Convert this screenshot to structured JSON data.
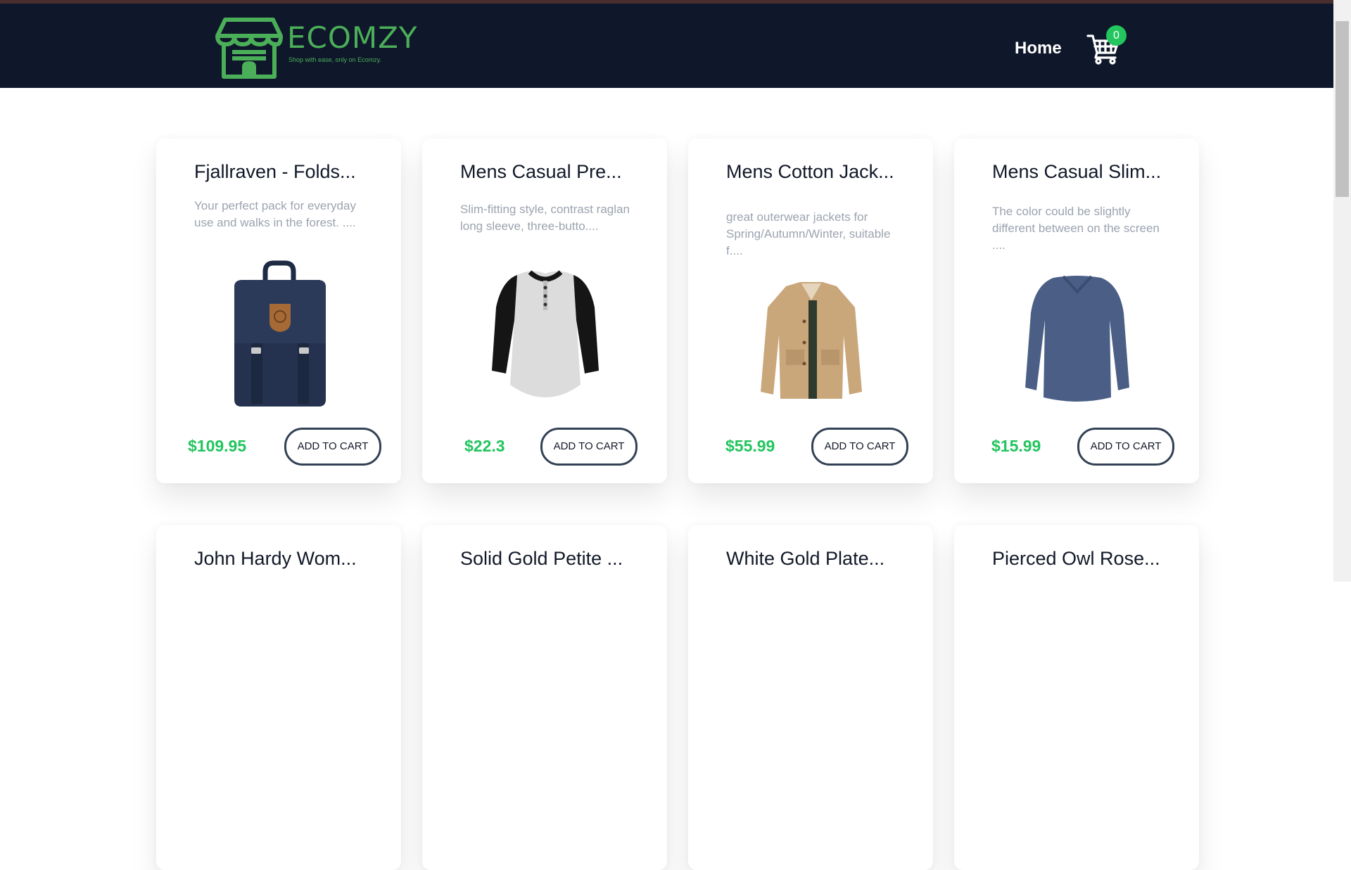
{
  "brand": {
    "name": "ECOMZY",
    "tagline": "Shop with ease, only on Ecomzy.",
    "color": "#4bae58"
  },
  "nav": {
    "home_label": "Home",
    "cart_icon": "shopping-cart-icon",
    "cart_count": "0"
  },
  "colors": {
    "navbar_bg": "#0f172a",
    "price": "#22c55e",
    "badge": "#22c55e"
  },
  "products": [
    {
      "title": "Fjallraven - Folds...",
      "description": "Your perfect pack for everyday use and walks in the forest. ....",
      "price": "$109.95",
      "button": "ADD TO CART",
      "image": "navy-backpack"
    },
    {
      "title": "Mens Casual Pre...",
      "description": "Slim-fitting style, contrast raglan long sleeve, three-butto....",
      "price": "$22.3",
      "button": "ADD TO CART",
      "image": "raglan-henley-shirt"
    },
    {
      "title": "Mens Cotton Jack...",
      "description": "great outerwear jackets for Spring/Autumn/Winter, suitable f....",
      "price": "$55.99",
      "button": "ADD TO CART",
      "image": "khaki-cotton-jacket"
    },
    {
      "title": "Mens Casual Slim...",
      "description": "The color could be slightly different between on the screen ....",
      "price": "$15.99",
      "button": "ADD TO CART",
      "image": "blue-long-sleeve-tee"
    },
    {
      "title": "John Hardy Wom..."
    },
    {
      "title": "Solid Gold Petite ..."
    },
    {
      "title": "White Gold Plate..."
    },
    {
      "title": "Pierced Owl Rose..."
    }
  ]
}
